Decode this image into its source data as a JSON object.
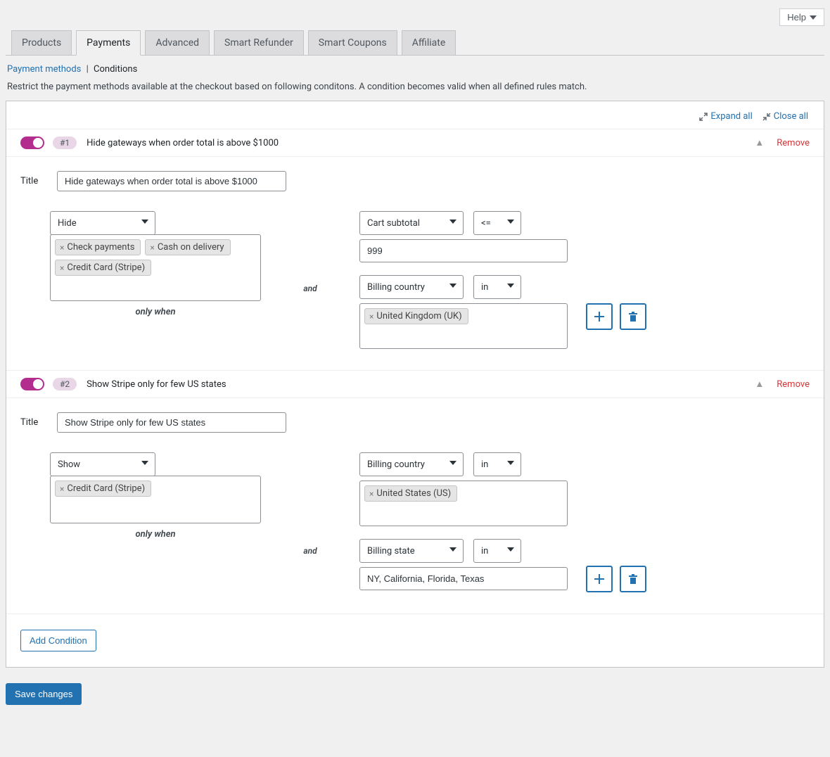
{
  "help_label": "Help",
  "tabs": [
    "Products",
    "Payments",
    "Advanced",
    "Smart Refunder",
    "Smart Coupons",
    "Affiliate"
  ],
  "subnav": {
    "methods": "Payment methods",
    "conditions": "Conditions"
  },
  "description": "Restrict the payment methods available at the checkout based on following conditons. A condition becomes valid when all defined rules match.",
  "expand_all": "Expand all",
  "close_all": "Close all",
  "remove_label": "Remove",
  "title_label": "Title",
  "only_when": "only when",
  "and": "and",
  "add_condition": "Add Condition",
  "save": "Save changes",
  "conditions": [
    {
      "badge": "#1",
      "name": "Hide gateways when order total is above $1000",
      "title_value": "Hide gateways when order total is above $1000",
      "action": "Hide",
      "gateways": [
        "Check payments",
        "Cash on delivery",
        "Credit Card (Stripe)"
      ],
      "rules": [
        {
          "field": "Cart subtotal",
          "op": "<=",
          "value": "999",
          "value_tags": null
        },
        {
          "field": "Billing country",
          "op": "in",
          "value": null,
          "value_tags": [
            "United Kingdom (UK)"
          ]
        }
      ]
    },
    {
      "badge": "#2",
      "name": "Show Stripe only for few US states",
      "title_value": "Show Stripe only for few US states",
      "action": "Show",
      "gateways": [
        "Credit Card (Stripe)"
      ],
      "rules": [
        {
          "field": "Billing country",
          "op": "in",
          "value": null,
          "value_tags": [
            "United States (US)"
          ]
        },
        {
          "field": "Billing state",
          "op": "in",
          "value": "NY, California, Florida, Texas",
          "value_tags": null
        }
      ]
    }
  ]
}
